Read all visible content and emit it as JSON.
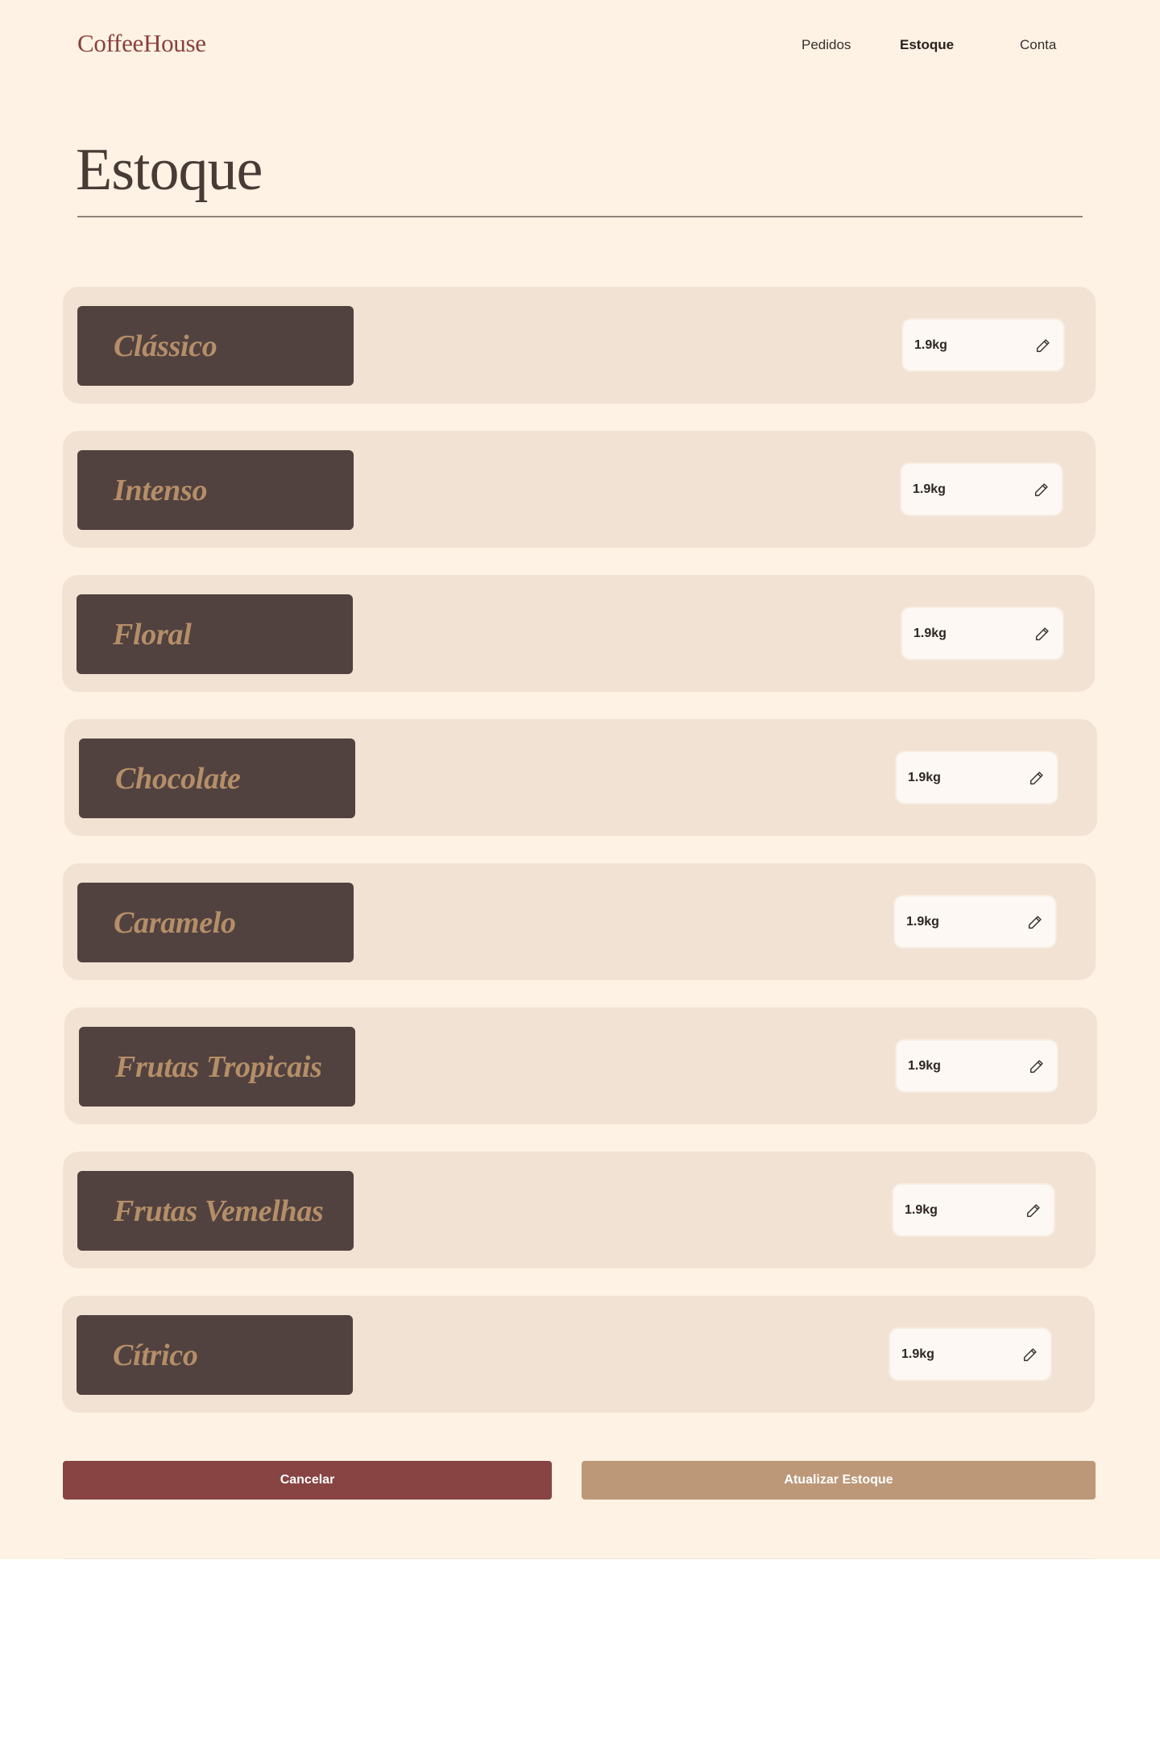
{
  "header": {
    "brand": "CoffeeHouse",
    "nav": [
      {
        "label": "Pedidos",
        "active": false
      },
      {
        "label": "Estoque",
        "active": true
      },
      {
        "label": "Conta",
        "active": false
      }
    ]
  },
  "main": {
    "title": "Estoque",
    "items": [
      {
        "name": "Clássico",
        "quantity": "1.9kg"
      },
      {
        "name": "Intenso",
        "quantity": "1.9kg"
      },
      {
        "name": "Floral",
        "quantity": "1.9kg"
      },
      {
        "name": "Chocolate",
        "quantity": "1.9kg"
      },
      {
        "name": "Caramelo",
        "quantity": "1.9kg"
      },
      {
        "name": "Frutas Tropicais",
        "quantity": "1.9kg"
      },
      {
        "name": "Frutas Vemelhas",
        "quantity": "1.9kg"
      },
      {
        "name": "Cítrico",
        "quantity": "1.9kg"
      }
    ],
    "edit_icon": "pencil-icon"
  },
  "actions": {
    "cancel_label": "Cancelar",
    "update_label": "Atualizar Estoque"
  },
  "colors": {
    "background": "#fdf2e4",
    "brand": "#8b3f3c",
    "card": "#f1e2d3",
    "name_box": "#514240",
    "name_text": "#b58e68",
    "cancel_button": "#874443",
    "update_button": "#bc9878"
  }
}
